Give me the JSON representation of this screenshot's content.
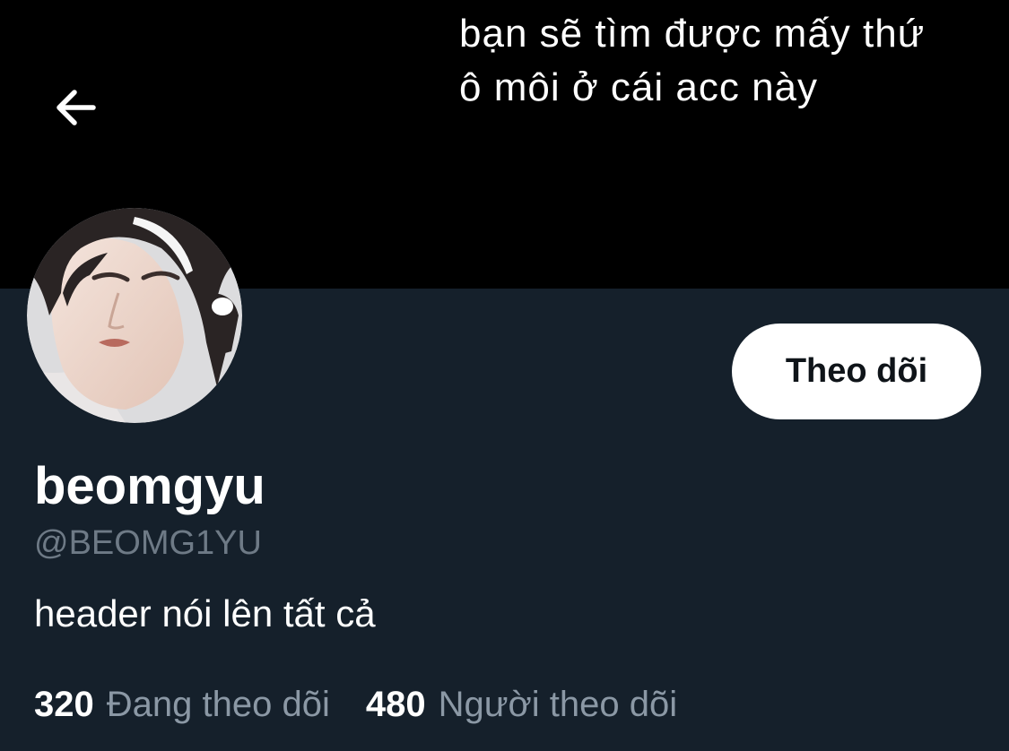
{
  "header": {
    "banner_lines": [
      "bạn sẽ tìm được mấy thứ",
      "ô môi ở cái acc này"
    ],
    "back_icon": "arrow-left-icon"
  },
  "profile": {
    "avatar_icon": "avatar-photo",
    "follow_label": "Theo dõi",
    "display_name": "beomgyu",
    "handle": "@BEOMG1YU",
    "bio": "header nói lên tất cả",
    "following": {
      "count": "320",
      "label": "Đang theo dõi"
    },
    "followers": {
      "count": "480",
      "label": "Người theo dõi"
    }
  },
  "colors": {
    "background": "#15202b",
    "banner": "#000000",
    "primary_text": "#ffffff",
    "secondary_text": "#8b98a5",
    "button_bg": "#ffffff",
    "button_text": "#0f1419"
  }
}
